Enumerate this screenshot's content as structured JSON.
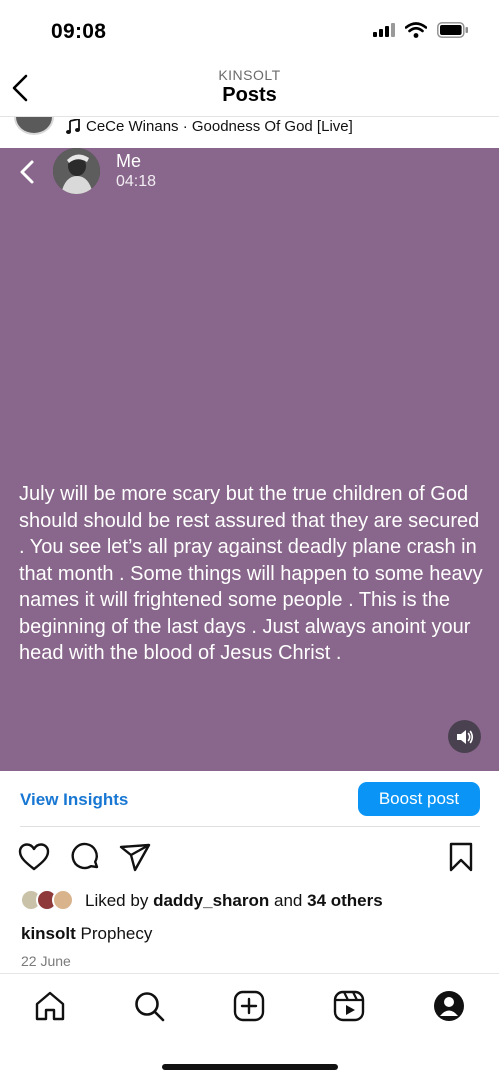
{
  "status_bar": {
    "time": "09:08"
  },
  "header": {
    "username": "KINSOLT",
    "title": "Posts"
  },
  "audio": {
    "track": "CeCe Winans · Goodness Of God [Live]"
  },
  "story": {
    "author": "Me",
    "time": "04:18",
    "background_color": "#89668b",
    "text": "July will be more scary but the true children of God should should be rest assured that they are secured .  You see let’s all pray against deadly plane crash in that month . Some things will happen to some heavy names it will frightened some people .  This is the beginning of the last days .  Just always anoint your head with the blood of Jesus Christ ."
  },
  "insights": {
    "link_label": "View Insights",
    "boost_label": "Boost post",
    "accent_color": "#0a95f6"
  },
  "actions": {
    "icons": [
      "heart-icon",
      "comment-icon",
      "share-icon",
      "bookmark-icon"
    ]
  },
  "likes": {
    "prefix": "Liked by",
    "user": "daddy_sharon",
    "joiner": "and",
    "others": "34 others"
  },
  "caption": {
    "username": "kinsolt",
    "text": "Prophecy"
  },
  "date": "22 June",
  "tabbar": {
    "tabs": [
      "home-icon",
      "search-icon",
      "create-icon",
      "reels-icon",
      "profile-icon"
    ]
  }
}
